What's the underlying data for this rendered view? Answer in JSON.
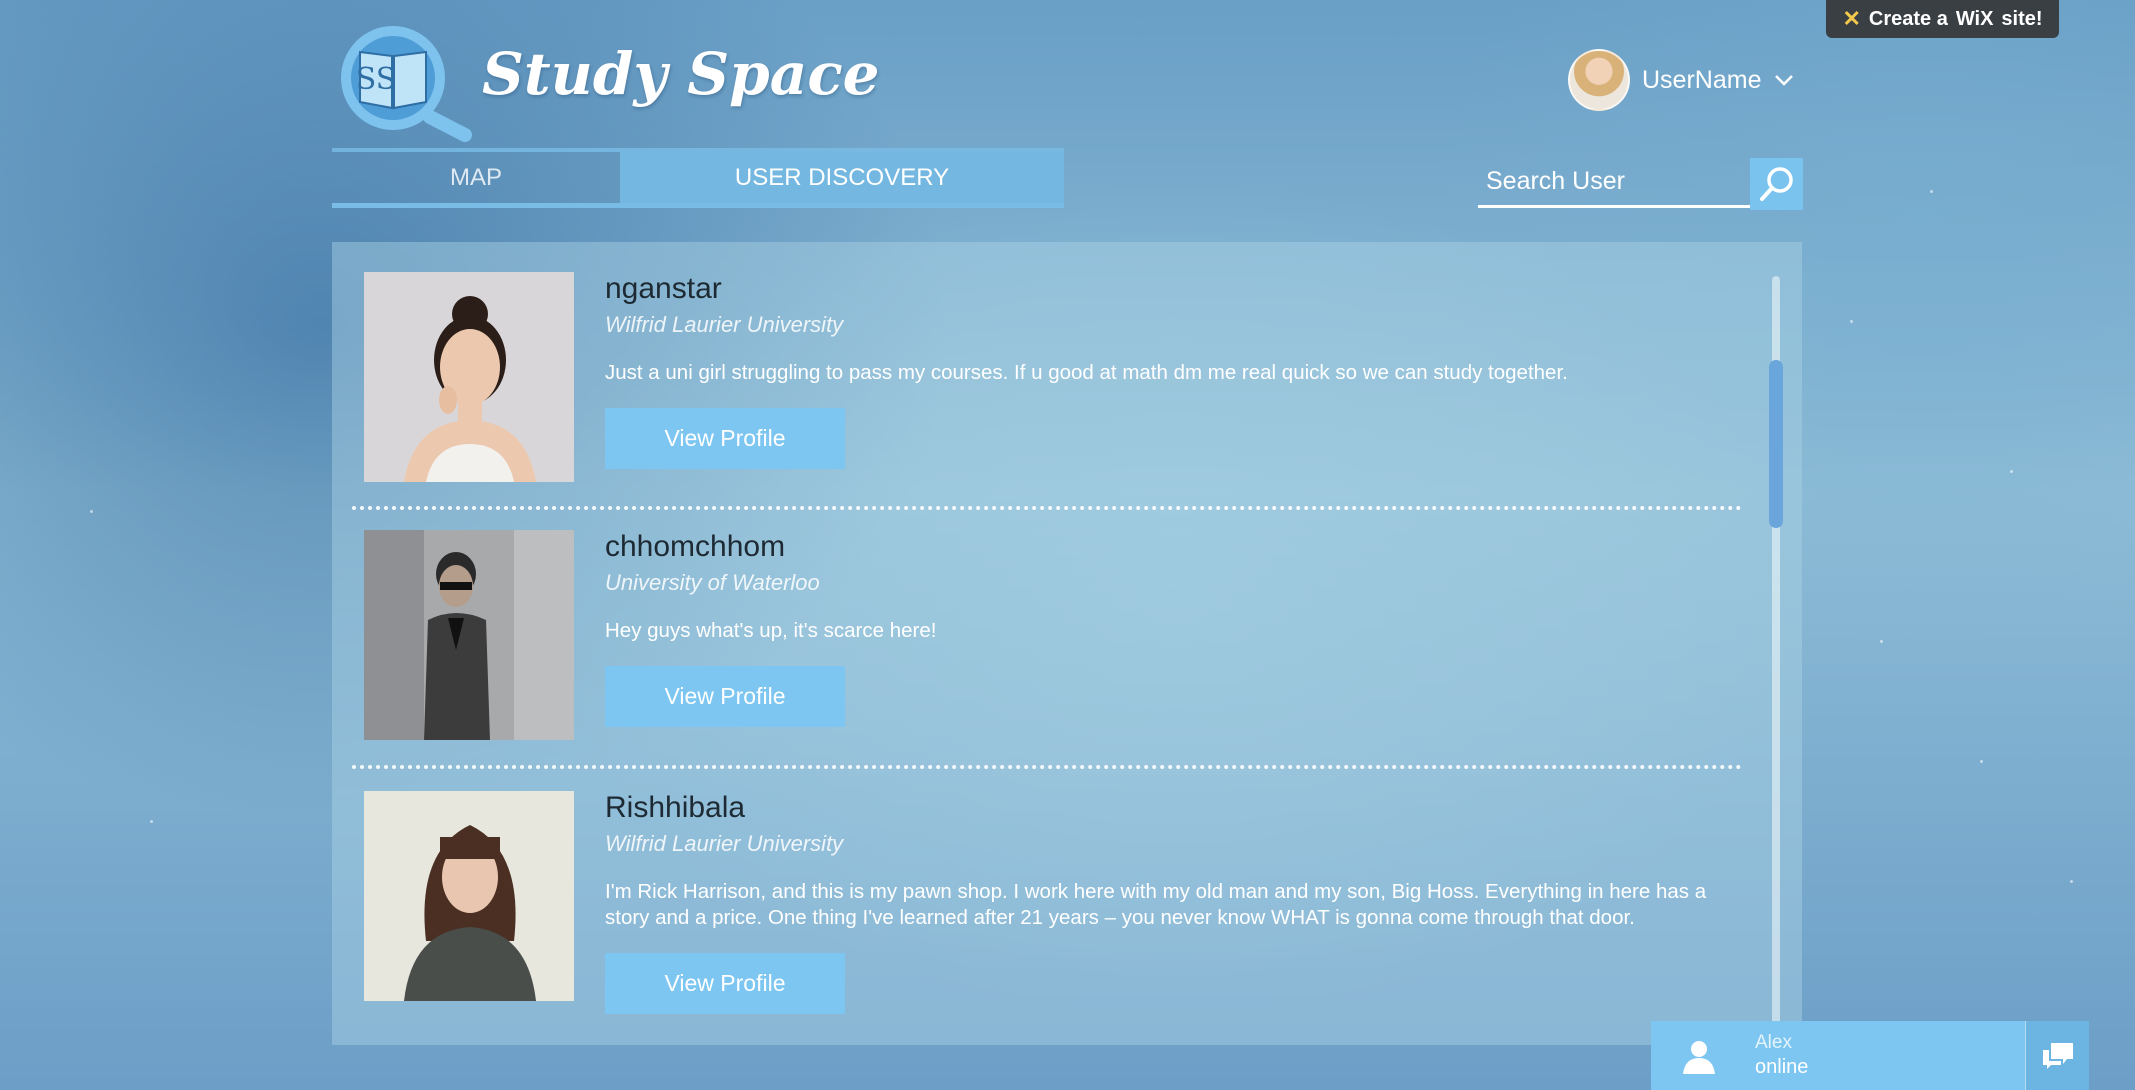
{
  "wix_banner": {
    "prefix": "Create a",
    "brand": "WiX",
    "suffix": "site!"
  },
  "logo": {
    "initials": "SS"
  },
  "brand": {
    "name": "Study Space"
  },
  "user": {
    "name": "UserName"
  },
  "tabs": [
    {
      "label": "MAP",
      "active": false
    },
    {
      "label": "USER DISCOVERY",
      "active": true
    }
  ],
  "search": {
    "placeholder": "Search User"
  },
  "users": [
    {
      "username": "nganstar",
      "university": "Wilfrid Laurier University",
      "bio": "Just a uni girl struggling to pass my courses. If u good at math dm me real quick so we can study together.",
      "button": "View Profile"
    },
    {
      "username": "chhomchhom",
      "university": "University of Waterloo",
      "bio": "Hey guys what's up, it's scarce here!",
      "button": "View Profile"
    },
    {
      "username": "Rishhibala",
      "university": "Wilfrid Laurier University",
      "bio": "I'm Rick Harrison, and this is my pawn shop. I work here with my old man and my son, Big Hoss. Everything in here has a story and a price. One thing I've learned after 21 years – you never know WHAT is gonna come through that door.",
      "button": "View Profile"
    }
  ],
  "chat": {
    "name": "Alex",
    "status": "online"
  },
  "colors": {
    "accent": "#7cc6f1",
    "tab_active": "#74b7e0",
    "scroll_thumb": "#6aa6dc"
  },
  "icons": [
    "book-magnifier-logo",
    "chevron-down-icon",
    "search-icon",
    "person-icon",
    "chat-bubbles-icon"
  ]
}
